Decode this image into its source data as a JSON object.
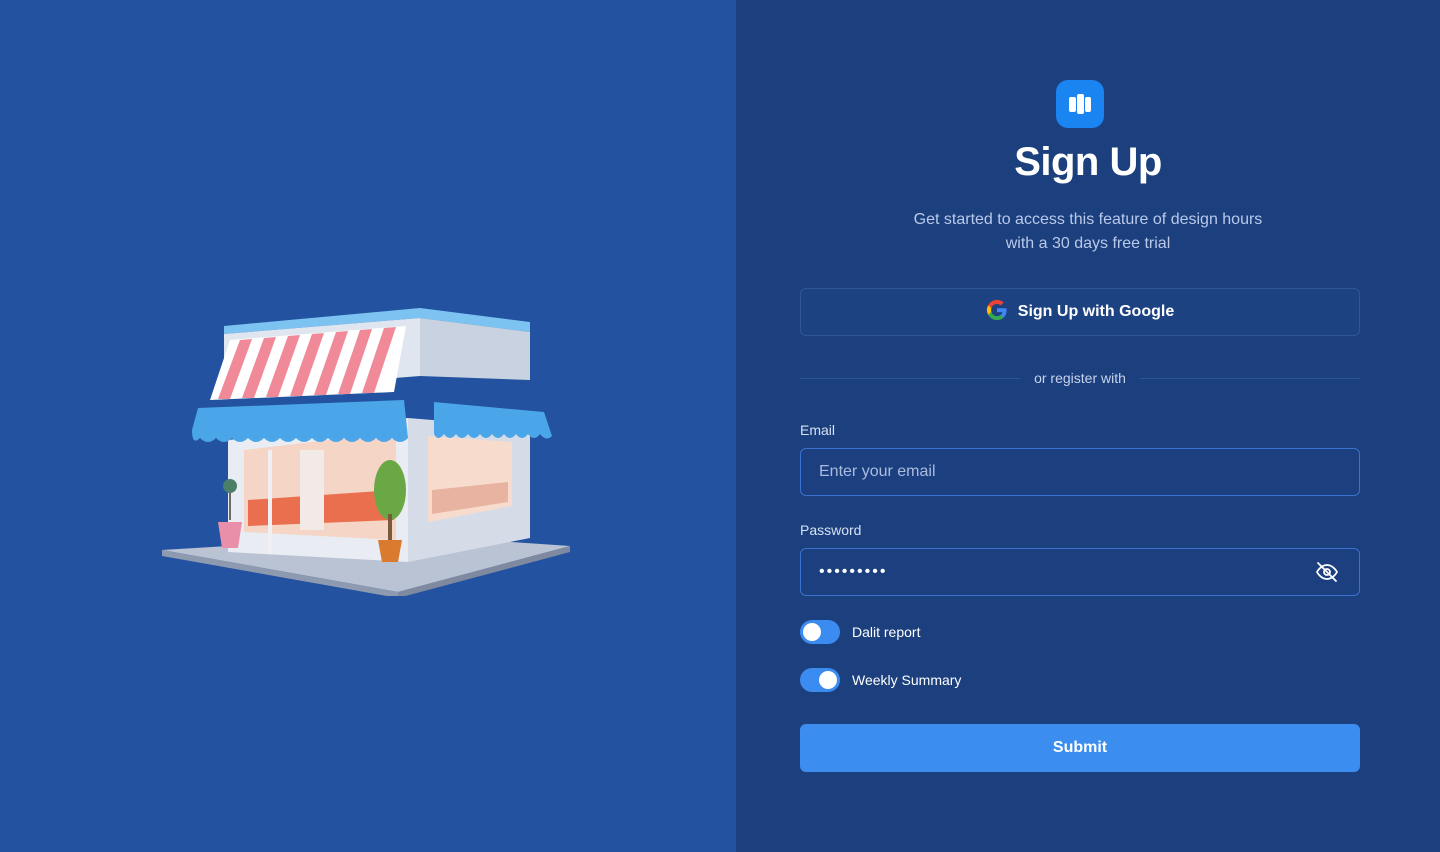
{
  "colors": {
    "left_panel_bg": "#2252a0",
    "right_panel_bg": "#1c3f7e",
    "accent": "#3b8ef0",
    "logo_bg": "#1a84f0"
  },
  "illustration": {
    "icon": "storefront-illustration"
  },
  "logo": {
    "icon": "app-logo-icon"
  },
  "header": {
    "title": "Sign Up",
    "subtitle_line1": "Get started to access this feature of design hours",
    "subtitle_line2": "with a 30 days free trial"
  },
  "google": {
    "label": "Sign Up with Google",
    "icon": "google-icon"
  },
  "divider": {
    "text": "or register with"
  },
  "email": {
    "label": "Email",
    "placeholder": "Enter your email",
    "value": ""
  },
  "password": {
    "label": "Password",
    "value_masked": "•••••••••",
    "toggle_icon": "eye-off-icon"
  },
  "toggles": [
    {
      "label": "Dalit report",
      "on": false
    },
    {
      "label": "Weekly Summary",
      "on": true
    }
  ],
  "submit": {
    "label": "Submit"
  }
}
